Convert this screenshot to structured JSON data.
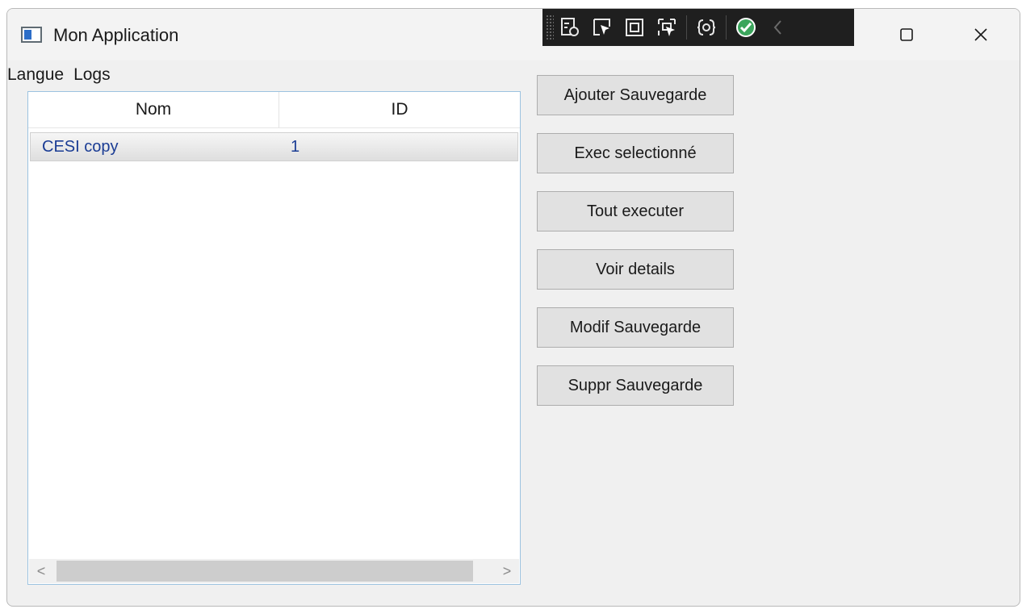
{
  "window": {
    "title": "Mon Application",
    "maximize_icon": "maximize-icon",
    "close_icon": "close-icon"
  },
  "devtools": {
    "icons": [
      "live-visual-tree-icon",
      "select-element-icon",
      "display-layout-adorners-icon",
      "track-focus-icon",
      "hot-reload-icon",
      "binding-check-icon",
      "collapse-chevron-icon"
    ]
  },
  "menu": {
    "items": [
      {
        "label": "Langue"
      },
      {
        "label": "Logs"
      }
    ]
  },
  "list": {
    "columns": [
      {
        "label": "Nom"
      },
      {
        "label": "ID"
      }
    ],
    "rows": [
      {
        "nom": "CESI copy",
        "id": "1"
      }
    ],
    "scroll_left": "<",
    "scroll_right": ">"
  },
  "actions": {
    "add": "Ajouter Sauvegarde",
    "exec_selected": "Exec selectionné",
    "exec_all": "Tout executer",
    "details": "Voir details",
    "modify": "Modif Sauvegarde",
    "delete": "Suppr Sauvegarde"
  },
  "colors": {
    "row_text": "#1a3c94",
    "list_border": "#9cc3e0",
    "button_bg": "#e1e1e1",
    "devbar_bg": "#1f1f1f",
    "check_green": "#3ba55c"
  }
}
